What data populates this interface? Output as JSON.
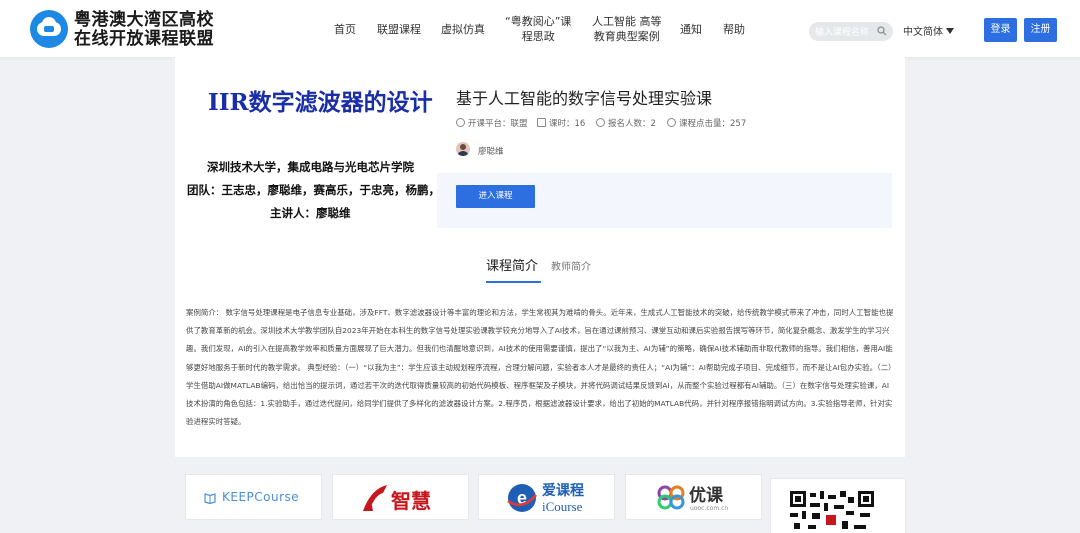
{
  "header": {
    "brand_line1": "粤港澳大湾区高校",
    "brand_line2": "在线开放课程联盟",
    "nav": [
      {
        "l1": "首页",
        "l2": ""
      },
      {
        "l1": "联盟课程",
        "l2": ""
      },
      {
        "l1": "虚拟仿真",
        "l2": ""
      },
      {
        "l1": "“粤教阅心”课",
        "l2": "程思政"
      },
      {
        "l1": "人工智能 高等",
        "l2": "教育典型案例"
      },
      {
        "l1": "通知",
        "l2": ""
      },
      {
        "l1": "帮助",
        "l2": ""
      }
    ],
    "search_placeholder": "输入课程名称",
    "language": "中文简体",
    "login": "登录",
    "register": "注册"
  },
  "cover": {
    "title": "IIR数字滤波器的设计",
    "line1": "深圳技术大学，集成电路与光电芯片学院",
    "line2": "团队：王志忠，廖聪维，赛高乐，于忠亮，杨鹏，",
    "line3": "主讲人：廖聪维"
  },
  "course": {
    "title": "基于人工智能的数字信号处理实验课",
    "platform": "开课平台：联盟",
    "hours": "课时：16",
    "enrolled": "报名人数：2",
    "clicks": "课程点击量：257",
    "teacher": "廖聪维",
    "enter_button": "进入课程"
  },
  "tabs": {
    "active": "课程简介",
    "inactive": "教师简介"
  },
  "description": "案例简介： 数字信号处理课程是电子信息专业基础，涉及FFT、数字滤波器设计等丰富的理论和方法，学生常视其为难啃的骨头。近年来，生成式人工智能技术的突破，给传统教学模式带来了冲击，同时人工智能也提供了教育革新的机会。深圳技术大学教学团队自2023年开始在本科生的数字信号处理实验课教学较充分地导入了AI技术，旨在通过课前预习、课堂互动和课后实验报告撰写等环节，简化复杂概念、激发学生的学习兴趣。我们发现，AI的引入在提高教学效率和质量方面展现了巨大潜力。但我们也清醒地意识到，AI技术的使用需要谨慎，提出了“以我为主、AI为辅”的策略，确保AI技术辅助而非取代教师的指导。我们相信，善用AI能够更好地服务于新时代的教学需求。 典型经验：（一）“以我为主”：学生应该主动规划程序流程，合理分解问题，实验者本人才是最终的责任人；“AI为辅”：AI帮助完成子项目、完成细节，而不是让AI包办实验。（二）学生借助AI做MATLAB编码，给出恰当的提示词，通过若干次的迭代取得质量较高的初始代码模板、程序框架及子模块，并将代码调试结果反馈到AI，从而整个实验过程都有AI辅助。（三）在数字信号处理实验课，AI技术扮演的角色包括：1.实验助手，通过迭代提问，给同学们提供了多样化的滤波器设计方案。2.程序员，根据滤波器设计要求，给出了初始的MATLAB代码，并针对程序报错指明调试方向。3.实验指导老师，针对实验进程实时答疑。",
  "partners": {
    "keep": "KEEPCourse",
    "zhihuishu": "智慧",
    "icourse_cn": "爱课程",
    "icourse_en": "iCourse",
    "youke": "优课",
    "youke_sub": "uooc.com.cn"
  },
  "colors": {
    "primary": "#2d6fe0",
    "cover_title": "#1a2ea8",
    "zhihuishu_red": "#c8161d"
  }
}
